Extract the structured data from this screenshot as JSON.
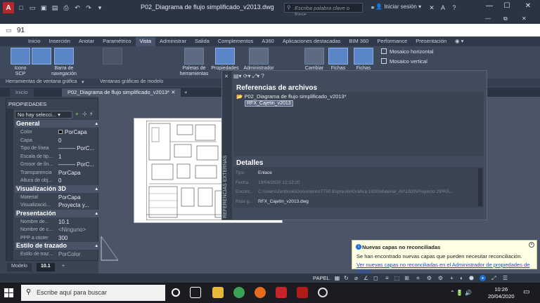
{
  "window": {
    "title": "P02_Diagrama de flujo simplificado_v2013.dwg",
    "search_placeholder": "Escriba palabra clave o frase",
    "signin": "Iniciar sesión",
    "app_letter": "A"
  },
  "command": {
    "value": "91"
  },
  "ribbon": {
    "tabs": [
      "Inicio",
      "Inserción",
      "Anotar",
      "Paramétrico",
      "Vista",
      "Administrar",
      "Salida",
      "Complementos",
      "A360",
      "Aplicaciones destacadas",
      "BIM 360",
      "Performance",
      "Presentación"
    ],
    "active_tab": "Vista",
    "buttons": {
      "ucs_icon": "Icono SCP",
      "nav_bar": "Barra de navegación",
      "tool_palettes": "Paletas de herramientas",
      "properties": "Propiedades",
      "manager": "Administrador",
      "change": "Cambiar",
      "file_tabs": "Fichas",
      "layout_tabs": "Fichas"
    },
    "tile_horizontal": "Mosaico horizontal",
    "tile_vertical": "Mosaico vertical",
    "groups": {
      "window_tools": "Herramientas de ventana gráfica",
      "model_viewports": "Ventanas gráficas de modelo"
    }
  },
  "file_tabs": {
    "start": "Inicio",
    "document": "P02_Diagrama de flujo simplificado_v2013*"
  },
  "properties": {
    "title": "PROPIEDADES",
    "selection": "No hay selecci...",
    "sections": [
      {
        "name": "General",
        "rows": [
          {
            "k": "Color",
            "v": "PorCapa"
          },
          {
            "k": "Capa",
            "v": "0"
          },
          {
            "k": "Tipo de línea",
            "v": "——— PorC..."
          },
          {
            "k": "Escala de tip...",
            "v": "1"
          },
          {
            "k": "Grosor de lín...",
            "v": "——— PorC..."
          },
          {
            "k": "Transparencia",
            "v": "PorCapa"
          },
          {
            "k": "Altura de obj...",
            "v": "0"
          }
        ]
      },
      {
        "name": "Visualización 3D",
        "rows": [
          {
            "k": "Material",
            "v": "PorCapa"
          },
          {
            "k": "Visualizació...",
            "v": "Proyecta y..."
          }
        ]
      },
      {
        "name": "Presentación",
        "rows": [
          {
            "k": "Nombre de...",
            "v": "10.1"
          },
          {
            "k": "Nombre de c...",
            "v": "<Ninguno>"
          },
          {
            "k": "PPP a ráster",
            "v": "300"
          }
        ]
      },
      {
        "name": "Estilo de trazado",
        "rows": [
          {
            "k": "Estilo de traz...",
            "v": "PorColor"
          }
        ]
      }
    ]
  },
  "layout_tabs": {
    "model": "Modelo",
    "layout": "10.1"
  },
  "xref": {
    "strip_label": "REFERENCIAS EXTERNAS",
    "file_refs_title": "Referencias de archivos",
    "tree_root": "P02_Diagrama de flujo simplificado_v2013*",
    "tree_child": "RFX_Cajetin_v2013",
    "details_title": "Detalles",
    "details": [
      {
        "k": "Tipo",
        "v": "Enlace"
      },
      {
        "k": "Fecha",
        "v": "19/04/2020 12:12:20"
      },
      {
        "k": "Encont...",
        "v": "C:\\Users\\Zenbook\\Documents\\7750 ExpresiónGráfica 1920\\Material_AV\\1920\\Proyecto 2\\PRÁ..."
      },
      {
        "k": "Ruta g...",
        "v": "RFX_Cajetin_v2013.dwg"
      }
    ]
  },
  "notification": {
    "title": "Nuevas capas no reconciliadas",
    "message": "Se han encontrado nuevas capas que pueden necesitar reconciliación.",
    "link": "Ver nuevas capas no reconciliadas en el Administrador de propiedades de capas"
  },
  "statusbar": {
    "space": "PAPEL"
  },
  "taskbar": {
    "search_placeholder": "Escribe aquí para buscar",
    "time": "10:26",
    "date": "20/04/2020"
  }
}
